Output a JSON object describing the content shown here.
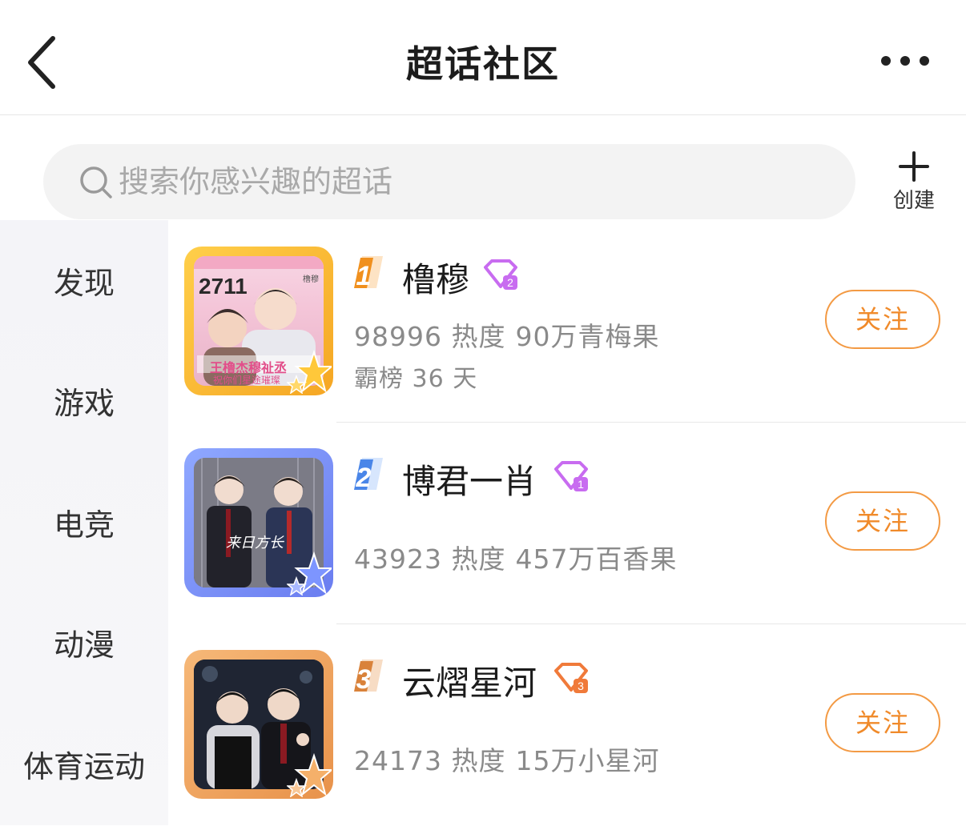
{
  "header": {
    "title": "超话社区"
  },
  "search": {
    "placeholder": "搜索你感兴趣的超话"
  },
  "create": {
    "label": "创建"
  },
  "sidebar": {
    "items": [
      {
        "label": "发现"
      },
      {
        "label": "游戏"
      },
      {
        "label": "电竞"
      },
      {
        "label": "动漫"
      },
      {
        "label": "体育运动"
      }
    ]
  },
  "list": {
    "items": [
      {
        "rank": "1",
        "name": "橹穆",
        "heat": "98996 热度",
        "fans": "90万青梅果",
        "extra": "霸榜 36 天",
        "follow_label": "关注",
        "gem_level": "2",
        "thumb_text": "2711",
        "thumb_caption": "王橹杰穆祉丞",
        "thumb_subcaption": "祝你们星途璀璨",
        "thumb_tag": "橹穆"
      },
      {
        "rank": "2",
        "name": "博君一肖",
        "heat": "43923 热度",
        "fans": "457万百香果",
        "follow_label": "关注",
        "gem_level": "1",
        "thumb_caption": "来日方长"
      },
      {
        "rank": "3",
        "name": "云熠星河",
        "heat": "24173 热度",
        "fans": "15万小星河",
        "follow_label": "关注",
        "gem_level": "3"
      }
    ]
  },
  "colors": {
    "accent": "#f08a2a",
    "rank1": "#f0901e",
    "rank2": "#4a86e8",
    "rank3": "#d9823a",
    "gem_purple": "#c86cf0",
    "gem_orange": "#f07a3a"
  }
}
